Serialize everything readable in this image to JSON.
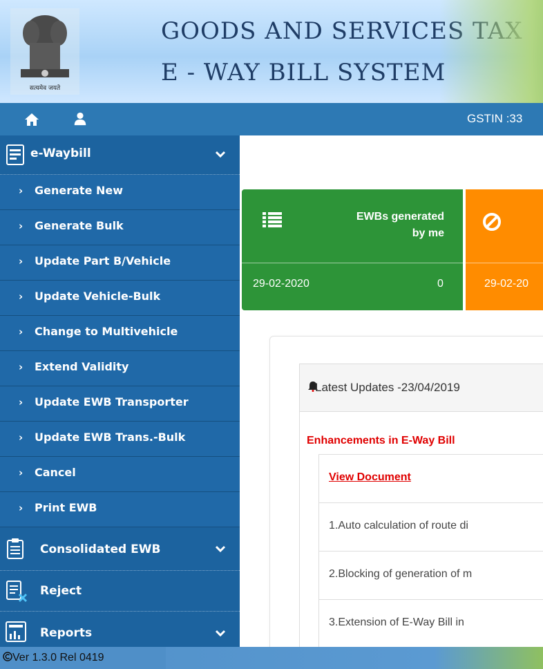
{
  "header": {
    "title_line1": "GOODS AND SERVICES TAX",
    "title_line2": "E - WAY BILL SYSTEM",
    "emblem_caption": "सत्यमेव जयते"
  },
  "topnav": {
    "home_icon": "home-icon",
    "user_icon": "user-icon",
    "gstin_label": "GSTIN :33"
  },
  "sidebar": {
    "ewaybill": {
      "label": "e-Waybill",
      "icon": "document-icon",
      "items": [
        "Generate New",
        "Generate Bulk",
        "Update Part B/Vehicle",
        "Update Vehicle-Bulk",
        "Change to Multivehicle",
        "Extend Validity",
        "Update EWB Transporter",
        "Update EWB Trans.-Bulk",
        "Cancel",
        "Print EWB"
      ]
    },
    "consolidated": {
      "label": "Consolidated EWB",
      "icon": "clipboard-icon"
    },
    "reject": {
      "label": "Reject",
      "icon": "reject-document-icon"
    },
    "reports": {
      "label": "Reports",
      "icon": "report-chart-icon"
    }
  },
  "cards": {
    "generated": {
      "title_line1": "EWBs generated",
      "title_line2": "by me",
      "date": "29-02-2020",
      "count": "0",
      "color": "#2d9438",
      "icon": "list-icon"
    },
    "cancelled": {
      "date": "29-02-20",
      "color": "#ff8c00",
      "icon": "ban-icon"
    }
  },
  "updates": {
    "title": "Latest Updates -23/04/2019",
    "heading": "Enhancements in E-Way Bill",
    "view_document": "View Document",
    "rows": [
      "1.Auto calculation of route di",
      "2.Blocking of generation of m",
      "3.Extension of E-Way Bill in"
    ]
  },
  "footer": {
    "version": "Ver 1.3.0 Rel 0419"
  },
  "colors": {
    "sidebar": "#2069a8",
    "topnav": "#2d79b4",
    "highlight_red": "#e00000"
  }
}
